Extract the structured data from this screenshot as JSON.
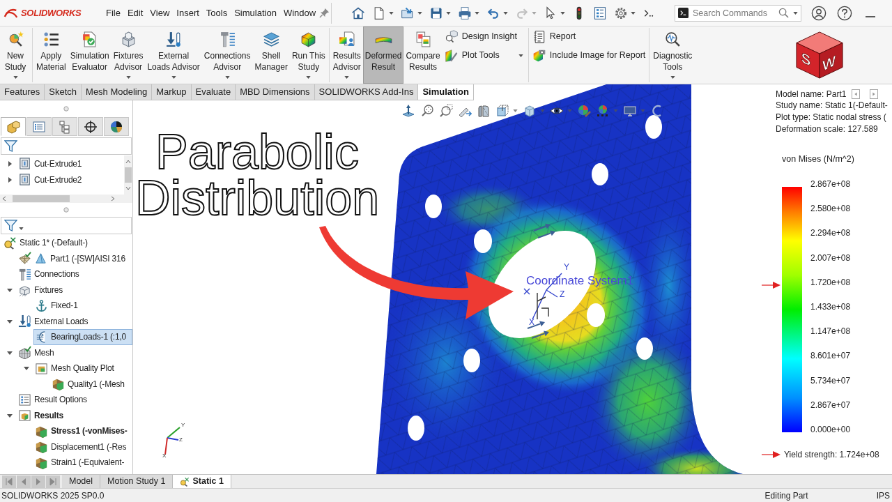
{
  "title_bar": {
    "logo": "SOLIDWORKS",
    "menu": [
      "File",
      "Edit",
      "View",
      "Insert",
      "Tools",
      "Simulation",
      "Window"
    ]
  },
  "quick_toolbar": [
    {
      "dropdown": false,
      "disabled": false
    },
    {
      "dropdown": true,
      "disabled": false
    },
    {
      "dropdown": true,
      "disabled": false
    },
    {
      "dropdown": true,
      "disabled": false
    },
    {
      "dropdown": true,
      "disabled": false
    },
    {
      "dropdown": true,
      "disabled": false
    },
    {
      "dropdown": true,
      "disabled": true
    },
    {
      "dropdown": true,
      "disabled": false
    },
    {
      "dropdown": false,
      "disabled": false
    },
    {
      "dropdown": false,
      "disabled": false
    },
    {
      "dropdown": true,
      "disabled": false
    },
    {
      "dropdown": false,
      "disabled": false
    }
  ],
  "search": {
    "placeholder": "Search Commands"
  },
  "ribbon": {
    "groups": [
      [
        {
          "label": "New\nStudy",
          "kind": "large",
          "dropdown": true,
          "pressed": false
        }
      ],
      [
        {
          "label": "Apply\nMaterial",
          "kind": "large",
          "dropdown": false,
          "pressed": false
        },
        {
          "label": "Simulation\nEvaluator",
          "kind": "large",
          "dropdown": false,
          "pressed": false
        },
        {
          "label": "Fixtures\nAdvisor",
          "kind": "large",
          "dropdown": true,
          "pressed": false
        },
        {
          "label": "External\nLoads Advisor",
          "kind": "large",
          "dropdown": true,
          "pressed": false
        },
        {
          "label": "Connections\nAdvisor",
          "kind": "large",
          "dropdown": true,
          "pressed": false
        },
        {
          "label": "Shell\nManager",
          "kind": "large",
          "dropdown": false,
          "pressed": false
        },
        {
          "label": "Run This\nStudy",
          "kind": "large",
          "dropdown": true,
          "pressed": false
        }
      ],
      [
        {
          "label": "Results\nAdvisor",
          "kind": "large",
          "dropdown": true,
          "pressed": false
        },
        {
          "label": "Deformed\nResult",
          "kind": "large",
          "dropdown": false,
          "pressed": true
        },
        {
          "label": "Compare\nResults",
          "kind": "large",
          "dropdown": false,
          "pressed": false
        },
        {
          "label": "Design Insight",
          "kind": "small",
          "dropdown": false,
          "pressed": false
        },
        {
          "label": "Plot Tools",
          "kind": "small",
          "dropdown": true,
          "pressed": false
        }
      ],
      [
        {
          "label": "Report",
          "kind": "small",
          "dropdown": false,
          "pressed": false
        },
        {
          "label": "Include Image for Report",
          "kind": "small",
          "dropdown": false,
          "pressed": false
        }
      ],
      [
        {
          "label": "Diagnostic\nTools",
          "kind": "large",
          "dropdown": true,
          "pressed": false
        }
      ]
    ]
  },
  "cube_logo": {
    "left_face": "S",
    "right_face": "W"
  },
  "command_tabs": [
    {
      "label": "Features",
      "selected": false
    },
    {
      "label": "Sketch",
      "selected": false
    },
    {
      "label": "Mesh Modeling",
      "selected": false
    },
    {
      "label": "Markup",
      "selected": false
    },
    {
      "label": "Evaluate",
      "selected": false
    },
    {
      "label": "MBD Dimensions",
      "selected": false
    },
    {
      "label": "SOLIDWORKS Add-Ins",
      "selected": false
    },
    {
      "label": "Simulation",
      "selected": true
    }
  ],
  "feature_manager": {
    "tabs": [
      {
        "selected": true
      },
      {
        "selected": false
      },
      {
        "selected": false
      },
      {
        "selected": false
      },
      {
        "selected": false
      }
    ],
    "feature_tree": [
      {
        "label": "Cut-Extrude1",
        "expanded": false,
        "selected": false
      },
      {
        "label": "Cut-Extrude2",
        "expanded": false,
        "selected": false
      }
    ],
    "study_tree": [
      {
        "label": "Static 1* (-Default-)",
        "kind": "study",
        "selected": false,
        "active": false,
        "children": [
          {
            "label": "Part1 (-[SW]AISI 316",
            "kind": "part",
            "selected": false,
            "active": false
          },
          {
            "label": "Connections",
            "kind": "connections",
            "selected": false,
            "active": false
          },
          {
            "label": "Fixtures",
            "kind": "fixtures",
            "selected": false,
            "active": false,
            "expanded": true,
            "children": [
              {
                "label": "Fixed-1",
                "kind": "fixture",
                "selected": false,
                "active": false
              }
            ]
          },
          {
            "label": "External Loads",
            "kind": "loads",
            "selected": false,
            "active": false,
            "expanded": true,
            "children": [
              {
                "label": "BearingLoads-1 (:1,0",
                "kind": "load",
                "selected": true,
                "active": false
              }
            ]
          },
          {
            "label": "Mesh",
            "kind": "mesh",
            "selected": false,
            "active": false,
            "expanded": true,
            "children": [
              {
                "label": "Mesh Quality Plot",
                "kind": "plot-folder",
                "selected": false,
                "active": false,
                "expanded": true,
                "children": [
                  {
                    "label": "Quality1 (-Mesh",
                    "kind": "plot",
                    "selected": false,
                    "active": false
                  }
                ]
              }
            ]
          },
          {
            "label": "Result Options",
            "kind": "options",
            "selected": false,
            "active": false
          },
          {
            "label": "Results",
            "kind": "results",
            "selected": false,
            "active": true,
            "expanded": true,
            "children": [
              {
                "label": "Stress1 (-vonMises-",
                "kind": "plot",
                "selected": false,
                "active": true
              },
              {
                "label": "Displacement1 (-Res",
                "kind": "plot",
                "selected": false,
                "active": false
              },
              {
                "label": "Strain1 (-Equivalent-",
                "kind": "plot",
                "selected": false,
                "active": false
              }
            ]
          }
        ]
      }
    ]
  },
  "graphics": {
    "view_toolbar": [
      {
        "dropdown": false
      },
      {
        "dropdown": false
      },
      {
        "dropdown": false
      },
      {
        "dropdown": false
      },
      {
        "dropdown": false
      },
      {
        "dropdown": true
      },
      {
        "dropdown": true
      },
      {
        "dropdown": true
      },
      {
        "dropdown": false
      },
      {
        "dropdown": true
      },
      {
        "dropdown": true
      },
      {
        "dropdown": false
      }
    ],
    "overlay_title": "Parabolic Distribution",
    "coordinate_system": {
      "label": "Coordinate System1",
      "axes": [
        "Y",
        "Z",
        "X"
      ]
    },
    "plot_info": [
      "Model name: Part1",
      "Study name: Static 1(-Default-",
      "Plot type: Static nodal stress (",
      "Deformation scale: 127.589"
    ],
    "legend": {
      "title": "von Mises (N/m^2)",
      "ticks": [
        "2.867e+08",
        "2.580e+08",
        "2.294e+08",
        "2.007e+08",
        "1.720e+08",
        "1.433e+08",
        "1.147e+08",
        "8.601e+07",
        "5.734e+07",
        "2.867e+07",
        "0.000e+00"
      ],
      "yield_marker": {
        "level": 0.6
      },
      "yield_strength": "Yield strength: 1.724e+08"
    },
    "view_triad": {
      "axes": [
        "Y",
        "Z",
        "X"
      ]
    }
  },
  "document_tabs": [
    {
      "label": "Model",
      "kind": "model",
      "selected": false
    },
    {
      "label": "Motion Study 1",
      "kind": "motion",
      "selected": false
    },
    {
      "label": "Static 1",
      "kind": "simulation",
      "selected": true
    }
  ],
  "status_bar": {
    "version": "SOLIDWORKS 2025 SP0.0",
    "mode": "Editing Part",
    "units": "IPS"
  }
}
